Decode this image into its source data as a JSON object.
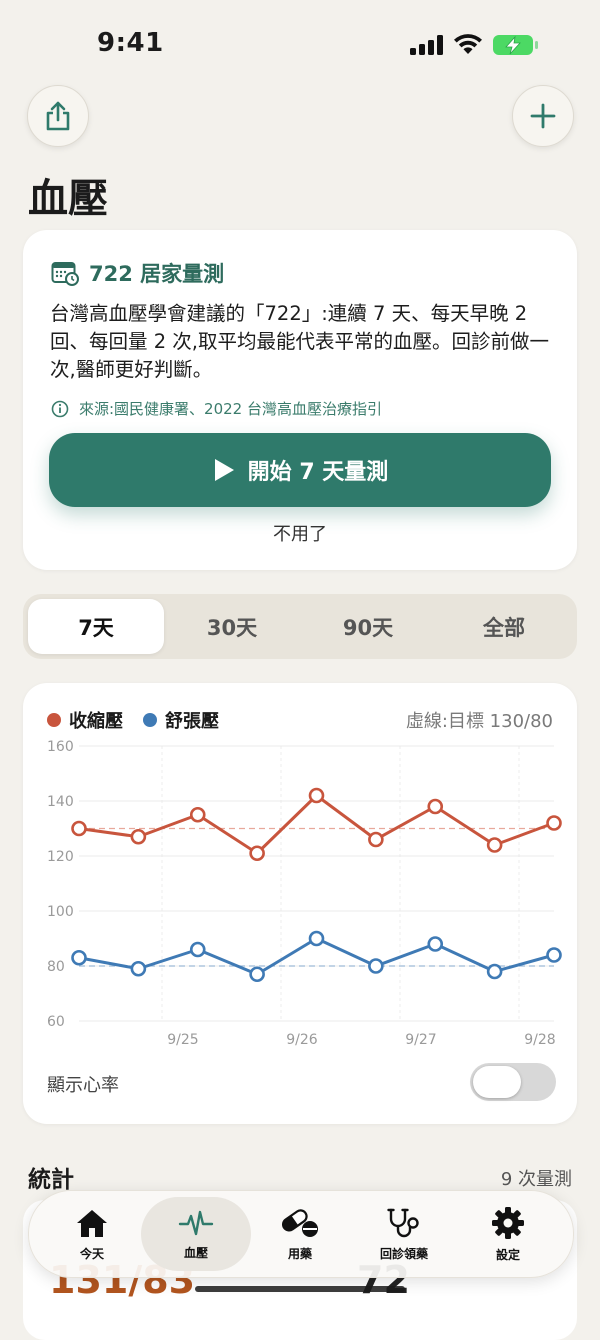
{
  "status_bar": {
    "time": "9:41"
  },
  "page": {
    "title": "血壓"
  },
  "info_card": {
    "heading": "722 居家量測",
    "description": "台灣高血壓學會建議的「722」:連續 7 天、每天早晚 2 回、每回量 2 次,取平均最能代表平常的血壓。回診前做一次,醫師更好判斷。",
    "source": "來源:國民健康署、2022 台灣高血壓治療指引",
    "start_button": "開始 7 天量測",
    "dismiss": "不用了"
  },
  "range_tabs": [
    {
      "label": "7天",
      "active": true
    },
    {
      "label": "30天",
      "active": false
    },
    {
      "label": "90天",
      "active": false
    },
    {
      "label": "全部",
      "active": false
    }
  ],
  "chart_data": {
    "type": "line",
    "legend": [
      "收縮壓",
      "舒張壓"
    ],
    "note": "虛線:目標 130/80",
    "x_ticks": [
      "9/25",
      "9/26",
      "9/27",
      "9/28"
    ],
    "y_ticks": [
      "160",
      "140",
      "120",
      "100",
      "80",
      "60"
    ],
    "ylim": [
      60,
      160
    ],
    "targets": {
      "systolic": 130,
      "diastolic": 80
    },
    "x": [
      0,
      1,
      2,
      3,
      4,
      5,
      6,
      7,
      8
    ],
    "series": [
      {
        "name": "收縮壓",
        "color": "#c8553d",
        "values": [
          130,
          127,
          135,
          121,
          142,
          126,
          138,
          124,
          132
        ]
      },
      {
        "name": "舒張壓",
        "color": "#3f7ab5",
        "values": [
          83,
          79,
          86,
          77,
          90,
          80,
          88,
          78,
          84
        ]
      }
    ]
  },
  "heart_rate_toggle": {
    "label": "顯示心率",
    "on": false
  },
  "stats": {
    "title": "統計",
    "count": "9 次量測",
    "value_bp": "131/83",
    "value_hr": "72"
  },
  "tab_bar": [
    {
      "label": "今天",
      "icon": "house-icon",
      "active": false
    },
    {
      "label": "血壓",
      "icon": "pulse-icon",
      "active": true
    },
    {
      "label": "用藥",
      "icon": "pill-icon",
      "active": false
    },
    {
      "label": "回診領藥",
      "icon": "stethoscope-icon",
      "active": false
    },
    {
      "label": "設定",
      "icon": "gear-icon",
      "active": false
    }
  ],
  "colors": {
    "accent": "#2f7a6b",
    "systolic": "#c8553d",
    "diastolic": "#3f7ab5",
    "background": "#f3f1ec"
  }
}
